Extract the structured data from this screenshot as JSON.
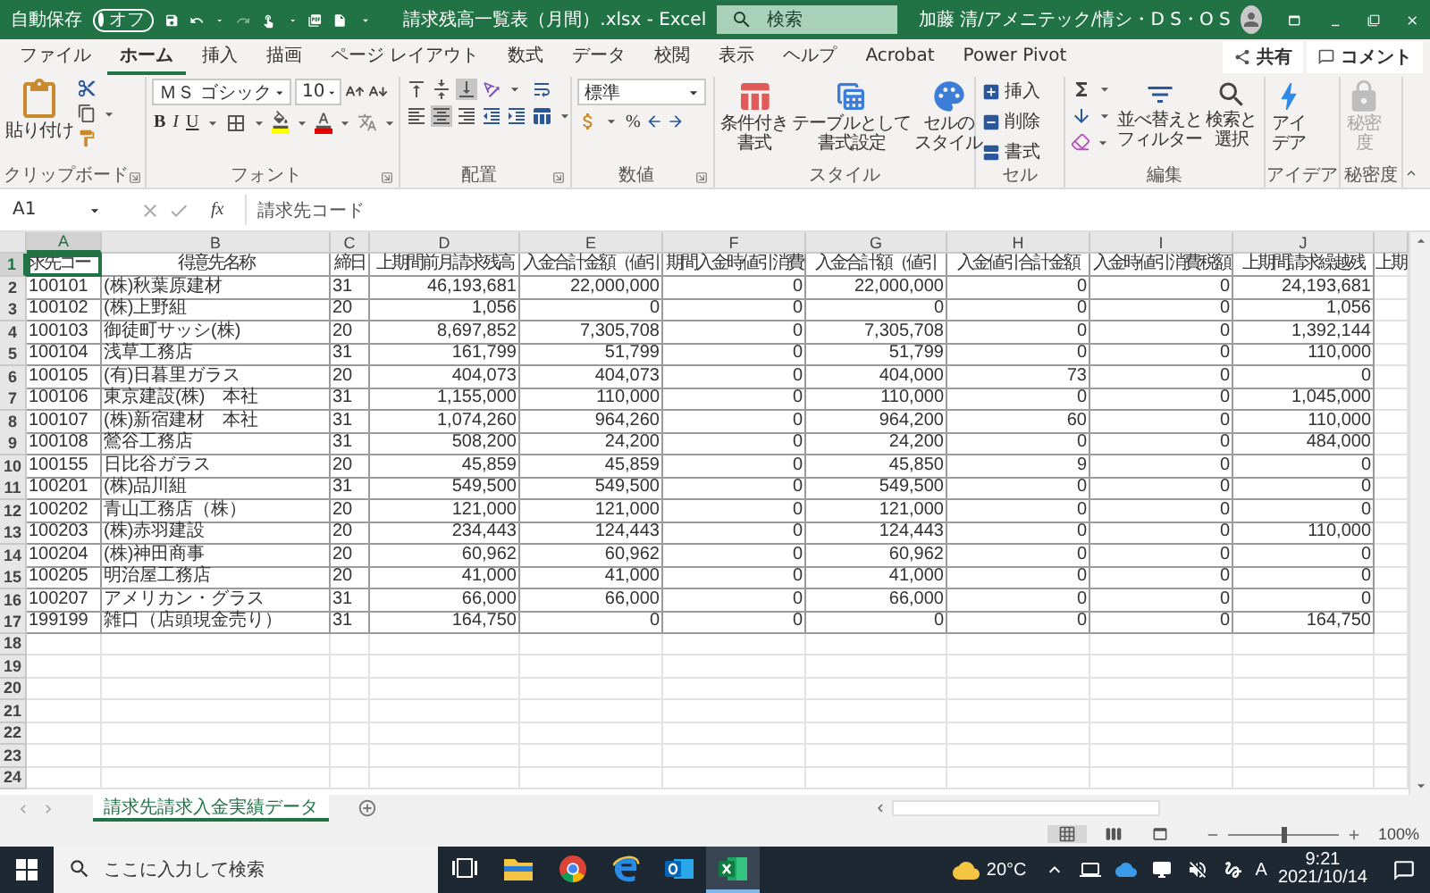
{
  "title_bar": {
    "autosave_label": "自動保存",
    "autosave": {
      "label": "オフ",
      "on": false
    },
    "title": "請求残高一覧表（月間）.xlsx - Excel",
    "search": {
      "placeholder": "検索"
    },
    "user": "加藤 清/アメニテック/情シ・D S・O S"
  },
  "tabs": [
    {
      "label": "ファイル",
      "selected": false
    },
    {
      "label": "ホーム",
      "selected": true
    },
    {
      "label": "挿入",
      "selected": false
    },
    {
      "label": "描画",
      "selected": false
    },
    {
      "label": "ページ レイアウト",
      "selected": false
    },
    {
      "label": "数式",
      "selected": false
    },
    {
      "label": "データ",
      "selected": false
    },
    {
      "label": "校閲",
      "selected": false
    },
    {
      "label": "表示",
      "selected": false
    },
    {
      "label": "ヘルプ",
      "selected": false
    },
    {
      "label": "Acrobat",
      "selected": false
    },
    {
      "label": "Power Pivot",
      "selected": false
    }
  ],
  "share": "共有",
  "comment": "コメント",
  "ribbon": [
    {
      "kind": "clipboard",
      "label": "クリップボード",
      "paste": "貼り付け"
    },
    {
      "kind": "font",
      "label": "フォント",
      "font_name": "ＭＳ ゴシック",
      "font_size": "10",
      "bold": "B",
      "italic": "I",
      "underline": "U"
    },
    {
      "kind": "alignment",
      "label": "配置"
    },
    {
      "kind": "number",
      "label": "数値",
      "format": "標準",
      "percent": "%"
    },
    {
      "kind": "large",
      "label": "スタイル",
      "buttons": [
        {
          "lines": [
            "条件付き",
            "書式"
          ],
          "disabled": false
        },
        {
          "lines": [
            "テーブルとして",
            "書式設定"
          ],
          "disabled": false
        },
        {
          "lines": [
            "セルの",
            "スタイル"
          ],
          "disabled": false
        }
      ]
    },
    {
      "kind": "list",
      "label": "セル",
      "items": [
        "挿入",
        "削除",
        "書式"
      ]
    },
    {
      "kind": "editing",
      "label": "編集",
      "buttons": [
        {
          "lines": [
            "並べ替えと",
            "フィルター"
          ],
          "disabled": false
        },
        {
          "lines": [
            "検索と",
            "選択"
          ],
          "disabled": false
        }
      ]
    },
    {
      "kind": "large",
      "label": "アイデア",
      "buttons": [
        {
          "lines": [
            "アイ",
            "デア"
          ],
          "disabled": false
        }
      ]
    },
    {
      "kind": "large",
      "label": "秘密度",
      "buttons": [
        {
          "lines": [
            "秘密",
            "度"
          ],
          "disabled": true
        }
      ]
    }
  ],
  "formula_bar": {
    "name_box": "A1",
    "fx": "fx",
    "formula": "請求先コード"
  },
  "sheet": {
    "header_n": "1",
    "columns": [
      {
        "letter": "A",
        "heading": "求先コー",
        "kind": "text"
      },
      {
        "letter": "B",
        "heading": "得意先名称",
        "kind": "text"
      },
      {
        "letter": "C",
        "heading": "締日",
        "kind": "text"
      },
      {
        "letter": "D",
        "heading": "上期間前月請求残高",
        "kind": "number"
      },
      {
        "letter": "E",
        "heading": "入金合計金額（値引",
        "kind": "number"
      },
      {
        "letter": "F",
        "heading": "期間入金時値引消費",
        "kind": "number"
      },
      {
        "letter": "G",
        "heading": "入金合計額（値引",
        "kind": "number"
      },
      {
        "letter": "H",
        "heading": "入金値引合計金額",
        "kind": "number"
      },
      {
        "letter": "I",
        "heading": "入金時値引消費税額",
        "kind": "number"
      },
      {
        "letter": "J",
        "heading": "上期間請求繰越残",
        "kind": "number"
      },
      {
        "heading": "上期",
        "kind": "text"
      }
    ],
    "rows": [
      {
        "n": "2",
        "cells": [
          "100101",
          "(株)秋葉原建材",
          "31",
          "46,193,681",
          "22,000,000",
          "0",
          "22,000,000",
          "0",
          "0",
          "24,193,681"
        ]
      },
      {
        "n": "3",
        "cells": [
          "100102",
          "(株)上野組",
          "20",
          "1,056",
          "0",
          "0",
          "0",
          "0",
          "0",
          "1,056"
        ]
      },
      {
        "n": "4",
        "cells": [
          "100103",
          "御徒町サッシ(株)",
          "20",
          "8,697,852",
          "7,305,708",
          "0",
          "7,305,708",
          "0",
          "0",
          "1,392,144"
        ]
      },
      {
        "n": "5",
        "cells": [
          "100104",
          "浅草工務店",
          "31",
          "161,799",
          "51,799",
          "0",
          "51,799",
          "0",
          "0",
          "110,000"
        ]
      },
      {
        "n": "6",
        "cells": [
          "100105",
          "(有)日暮里ガラス",
          "20",
          "404,073",
          "404,073",
          "0",
          "404,000",
          "73",
          "0",
          "0"
        ]
      },
      {
        "n": "7",
        "cells": [
          "100106",
          "東京建設(株)　本社",
          "31",
          "1,155,000",
          "110,000",
          "0",
          "110,000",
          "0",
          "0",
          "1,045,000"
        ]
      },
      {
        "n": "8",
        "cells": [
          "100107",
          "(株)新宿建材　本社",
          "31",
          "1,074,260",
          "964,260",
          "0",
          "964,200",
          "60",
          "0",
          "110,000"
        ]
      },
      {
        "n": "9",
        "cells": [
          "100108",
          "鶯谷工務店",
          "31",
          "508,200",
          "24,200",
          "0",
          "24,200",
          "0",
          "0",
          "484,000"
        ]
      },
      {
        "n": "10",
        "cells": [
          "100155",
          "日比谷ガラス",
          "20",
          "45,859",
          "45,859",
          "0",
          "45,850",
          "9",
          "0",
          "0"
        ]
      },
      {
        "n": "11",
        "cells": [
          "100201",
          "(株)品川組",
          "31",
          "549,500",
          "549,500",
          "0",
          "549,500",
          "0",
          "0",
          "0"
        ]
      },
      {
        "n": "12",
        "cells": [
          "100202",
          "青山工務店（株）",
          "20",
          "121,000",
          "121,000",
          "0",
          "121,000",
          "0",
          "0",
          "0"
        ]
      },
      {
        "n": "13",
        "cells": [
          "100203",
          "(株)赤羽建設",
          "20",
          "234,443",
          "124,443",
          "0",
          "124,443",
          "0",
          "0",
          "110,000"
        ]
      },
      {
        "n": "14",
        "cells": [
          "100204",
          "(株)神田商事",
          "20",
          "60,962",
          "60,962",
          "0",
          "60,962",
          "0",
          "0",
          "0"
        ]
      },
      {
        "n": "15",
        "cells": [
          "100205",
          "明治屋工務店",
          "20",
          "41,000",
          "41,000",
          "0",
          "41,000",
          "0",
          "0",
          "0"
        ]
      },
      {
        "n": "16",
        "cells": [
          "100207",
          "アメリカン・グラス",
          "31",
          "66,000",
          "66,000",
          "0",
          "66,000",
          "0",
          "0",
          "0"
        ]
      },
      {
        "n": "17",
        "cells": [
          "199199",
          "雑口（店頭現金売り）",
          "31",
          "164,750",
          "0",
          "0",
          "0",
          "0",
          "0",
          "164,750"
        ]
      },
      {
        "n": "18"
      },
      {
        "n": "19"
      },
      {
        "n": "20"
      },
      {
        "n": "21"
      },
      {
        "n": "22"
      },
      {
        "n": "23"
      },
      {
        "n": "24"
      }
    ]
  },
  "sheet_tabs": [
    {
      "label": "請求先請求入金実績データ",
      "selected": true
    }
  ],
  "status_bar": {
    "views": [
      {
        "selected": true
      },
      {
        "selected": false
      },
      {
        "selected": false
      }
    ],
    "zoom": {
      "level": 0.5,
      "reading": "100%"
    }
  },
  "taskbar": {
    "search": {
      "placeholder": "ここに入力して検索"
    },
    "apps": [
      {
        "kind": "taskview",
        "selected": false
      },
      {
        "kind": "folder",
        "selected": false
      },
      {
        "kind": "chrome",
        "selected": false
      },
      {
        "kind": "edge",
        "selected": false
      },
      {
        "kind": "outlook",
        "selected": false
      },
      {
        "kind": "excel",
        "selected": true
      }
    ],
    "temperature": "20°C",
    "ime": "A",
    "time": "9:21",
    "date": "2021/10/14"
  }
}
